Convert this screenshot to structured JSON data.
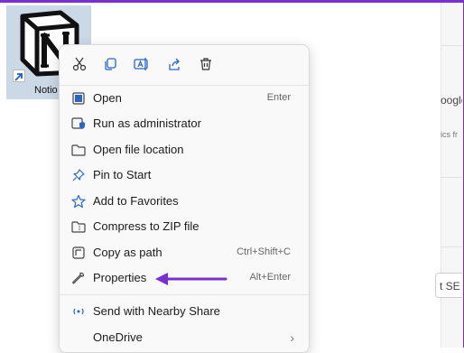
{
  "desktop": {
    "icon_label": "Notio"
  },
  "background": {
    "fragments": [
      "oogle",
      "ics fr",
      "t SE"
    ]
  },
  "toolbar": {
    "cut": "cut-icon",
    "copy": "copy-icon",
    "rename": "rename-icon",
    "share": "share-icon",
    "delete": "delete-icon"
  },
  "menu": {
    "items": [
      {
        "label": "Open",
        "shortcut": "Enter"
      },
      {
        "label": "Run as administrator",
        "shortcut": ""
      },
      {
        "label": "Open file location",
        "shortcut": ""
      },
      {
        "label": "Pin to Start",
        "shortcut": ""
      },
      {
        "label": "Add to Favorites",
        "shortcut": ""
      },
      {
        "label": "Compress to ZIP file",
        "shortcut": ""
      },
      {
        "label": "Copy as path",
        "shortcut": "Ctrl+Shift+C"
      },
      {
        "label": "Properties",
        "shortcut": "Alt+Enter"
      },
      {
        "label": "Send with Nearby Share",
        "shortcut": ""
      },
      {
        "label": "OneDrive",
        "shortcut": ""
      }
    ]
  },
  "colors": {
    "accent": "#7a2fd0",
    "icon_blue": "#2a66c8"
  }
}
